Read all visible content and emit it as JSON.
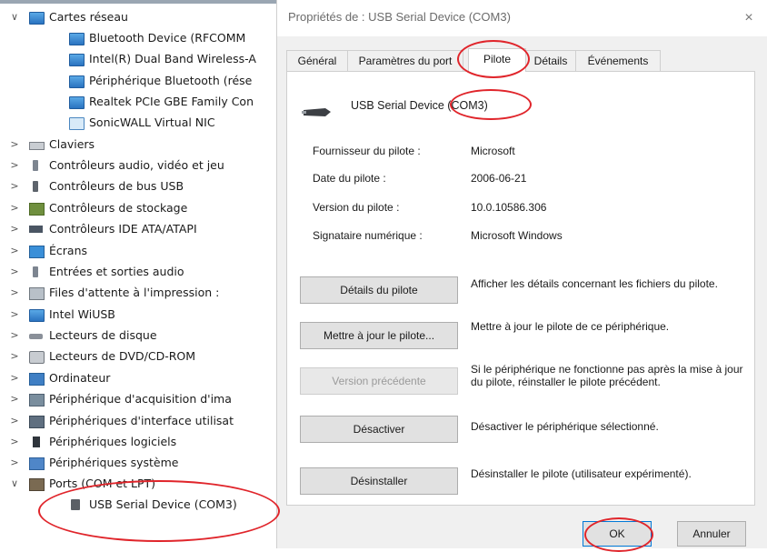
{
  "tree": {
    "rows": [
      {
        "label": "Cartes réseau",
        "arrow": "∨",
        "icon": "network-adapter-icon"
      },
      {
        "label": "Bluetooth Device (RFCOMM",
        "icon": "network-card-icon"
      },
      {
        "label": "Intel(R) Dual Band Wireless-A",
        "icon": "network-card-icon"
      },
      {
        "label": "Périphérique Bluetooth (rése",
        "icon": "network-card-icon"
      },
      {
        "label": "Realtek PCIe GBE Family Con",
        "icon": "network-card-icon"
      },
      {
        "label": "SonicWALL Virtual NIC",
        "icon": "virtual-nic-icon"
      },
      {
        "label": "Claviers",
        "arrow": ">",
        "icon": "keyboard-icon"
      },
      {
        "label": "Contrôleurs audio, vidéo et jeu",
        "arrow": ">",
        "icon": "speaker-icon"
      },
      {
        "label": "Contrôleurs de bus USB",
        "arrow": ">",
        "icon": "usb-icon"
      },
      {
        "label": "Contrôleurs de stockage",
        "arrow": ">",
        "icon": "storage-icon"
      },
      {
        "label": "Contrôleurs IDE ATA/ATAPI",
        "arrow": ">",
        "icon": "ide-icon"
      },
      {
        "label": "Écrans",
        "arrow": ">",
        "icon": "monitor-icon"
      },
      {
        "label": "Entrées et sorties audio",
        "arrow": ">",
        "icon": "speaker-icon"
      },
      {
        "label": "Files d'attente à l'impression :",
        "arrow": ">",
        "icon": "printer-icon"
      },
      {
        "label": "Intel WiUSB",
        "arrow": ">",
        "icon": "network-card-icon"
      },
      {
        "label": "Lecteurs de disque",
        "arrow": ">",
        "icon": "disk-drive-icon"
      },
      {
        "label": "Lecteurs de DVD/CD-ROM",
        "arrow": ">",
        "icon": "dvd-drive-icon"
      },
      {
        "label": "Ordinateur",
        "arrow": ">",
        "icon": "computer-icon"
      },
      {
        "label": "Périphérique d'acquisition d'ima",
        "arrow": ">",
        "icon": "scanner-icon"
      },
      {
        "label": "Périphériques d'interface utilisat",
        "arrow": ">",
        "icon": "hid-icon"
      },
      {
        "label": "Périphériques logiciels",
        "arrow": ">",
        "icon": "software-device-icon"
      },
      {
        "label": "Périphériques système",
        "arrow": ">",
        "icon": "system-device-icon"
      },
      {
        "label": "Ports (COM et LPT)",
        "arrow": "∨",
        "icon": "port-icon"
      },
      {
        "label": "USB Serial Device (COM3)",
        "icon": "serial-device-icon"
      }
    ]
  },
  "dialog": {
    "title": "Propriétés de : USB Serial Device (COM3)",
    "close": "×",
    "tabs": [
      "Général",
      "Paramètres du port",
      "Pilote",
      "Détails",
      "Événements"
    ],
    "active_tab": "Pilote",
    "device_name": "USB Serial Device (COM3)",
    "info": [
      {
        "label": "Fournisseur du pilote :",
        "value": "Microsoft"
      },
      {
        "label": "Date du pilote :",
        "value": "2006-06-21"
      },
      {
        "label": "Version du pilote :",
        "value": "10.0.10586.306"
      },
      {
        "label": "Signataire numérique :",
        "value": "Microsoft Windows"
      }
    ],
    "actions": [
      {
        "button": "Détails du pilote",
        "desc": "Afficher les détails concernant les fichiers du pilote.",
        "enabled": true
      },
      {
        "button": "Mettre à jour le pilote...",
        "desc": "Mettre à jour le pilote de ce périphérique.",
        "enabled": true
      },
      {
        "button": "Version précédente",
        "desc": "Si le périphérique ne fonctionne pas après la mise à jour du pilote, réinstaller le pilote précédent.",
        "enabled": false
      },
      {
        "button": "Désactiver",
        "desc": "Désactiver le périphérique sélectionné.",
        "enabled": true
      },
      {
        "button": "Désinstaller",
        "desc": "Désinstaller le pilote (utilisateur expérimenté).",
        "enabled": true
      }
    ],
    "ok": "OK",
    "cancel": "Annuler"
  },
  "colors": {
    "annotation": "#e0252b",
    "dialog_bg": "#f0f0f0",
    "focus": "#0078d7"
  }
}
